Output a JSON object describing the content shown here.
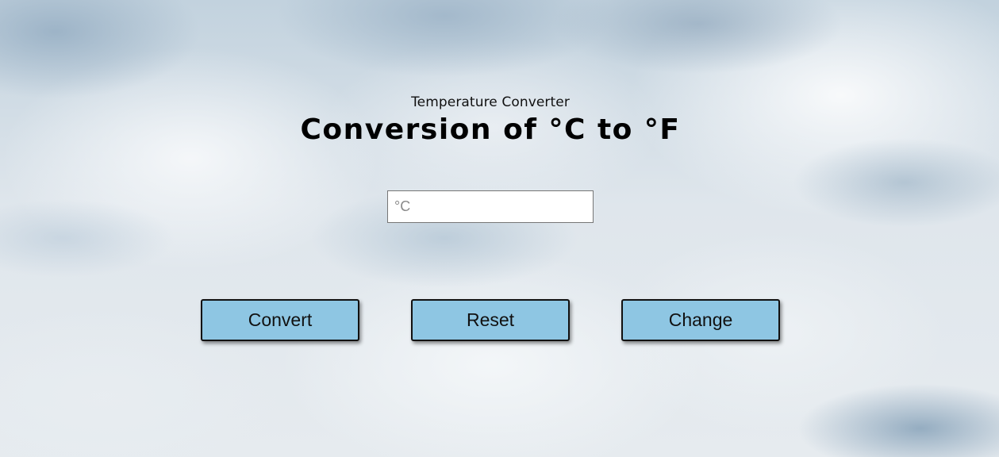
{
  "header": {
    "subtitle": "Temperature Converter",
    "title": "Conversion of °C to °F"
  },
  "input": {
    "placeholder": "°C",
    "value": ""
  },
  "buttons": {
    "convert": "Convert",
    "reset": "Reset",
    "change": "Change"
  },
  "colors": {
    "button_fill": "#8ec6e3",
    "button_border": "#111111"
  }
}
